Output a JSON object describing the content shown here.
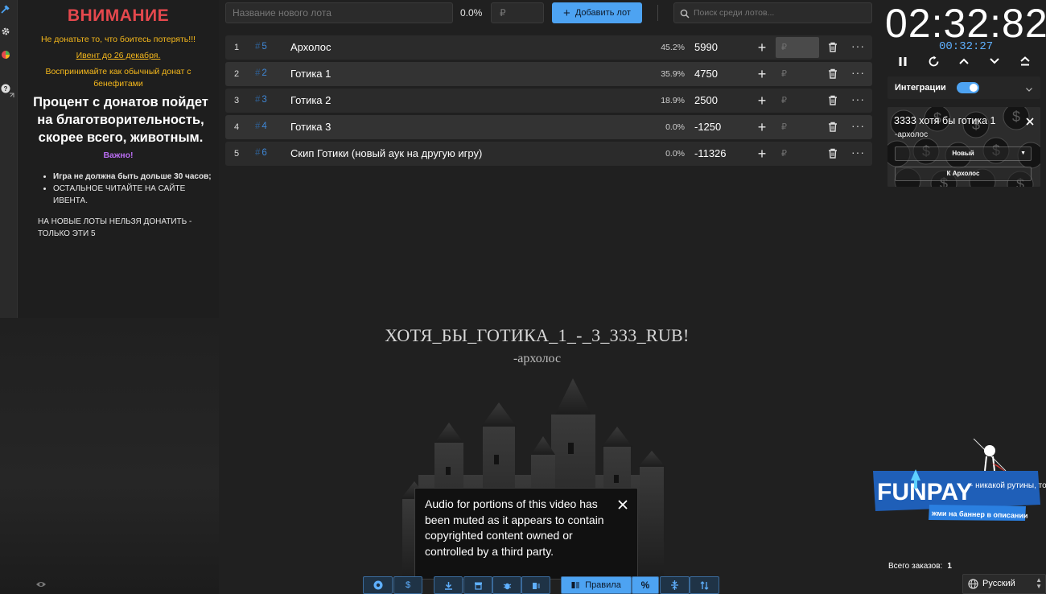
{
  "rules": {
    "warning": "ВНИМАНИЕ",
    "line1": "Не донатьте то, что боитесь потерять!!!",
    "line2": "Ивент до 26 декабря.",
    "line3": "Воспринимайте как обычный донат с бенефитами",
    "charity": "Процент с донатов пойдет на благотворительность, скорее всего, животным.",
    "important": "Важно!",
    "bullet1": "Игра не должна быть дольше 30 часов;",
    "bullet2": "ОСТАЛЬНОЕ ЧИТАЙТЕ НА САЙТЕ ИВЕНТА.",
    "no_new_lots": "НА НОВЫЕ ЛОТЫ НЕЛЬЗЯ ДОНАТИТЬ - ТОЛЬКО ЭТИ 5"
  },
  "toolbar": {
    "new_lot_placeholder": "Название нового лота",
    "percent": "0.0%",
    "currency_placeholder": "₽",
    "add_lot_label": "Добавить лот",
    "search_placeholder": "Поиск среди лотов..."
  },
  "lots": [
    {
      "num": "1",
      "id": "5",
      "name": "Архолос",
      "percent": "45.2%",
      "amount": "5990",
      "currency": "₽"
    },
    {
      "num": "2",
      "id": "2",
      "name": "Готика 1",
      "percent": "35.9%",
      "amount": "4750",
      "currency": "₽"
    },
    {
      "num": "3",
      "id": "3",
      "name": "Готика 2",
      "percent": "18.9%",
      "amount": "2500",
      "currency": "₽"
    },
    {
      "num": "4",
      "id": "4",
      "name": "Готика 3",
      "percent": "0.0%",
      "amount": "-1250",
      "currency": "₽"
    },
    {
      "num": "5",
      "id": "6",
      "name": "Скип Готики (новый аук на другую игру)",
      "percent": "0.0%",
      "amount": "-11326",
      "currency": "₽"
    }
  ],
  "hash_symbol": "#",
  "donation_message": {
    "text": "ХОТЯ_БЫ_ГОТИКА_1_-_3_333_RUB!",
    "author": "-архолос"
  },
  "notice": {
    "text": "Audio for portions of this video has been muted as it appears to contain copyrighted content owned or controlled by a third party."
  },
  "bottom_toolbar": {
    "rules_label": "Правила",
    "percent_label": "%"
  },
  "timer": {
    "main": "02:32:82",
    "sub": "00:32:27"
  },
  "integrations": {
    "label": "Интеграции",
    "enabled": true
  },
  "donation_card": {
    "title": "3333 хотя бы готика 1",
    "author": "-архолос",
    "status": "Новый",
    "target_button": "К Архолос"
  },
  "banner": {
    "brand": "FUNPAY",
    "tagline": "- никакой рутины, только фан",
    "cta": "жми на баннер в описании"
  },
  "orders": {
    "label": "Всего заказов:",
    "count": "1"
  },
  "language": {
    "selected": "Русский"
  },
  "colors": {
    "accent": "#4da3f2",
    "warning": "#e5484d",
    "highlight": "#f5b81c",
    "important": "#b86cf0"
  }
}
